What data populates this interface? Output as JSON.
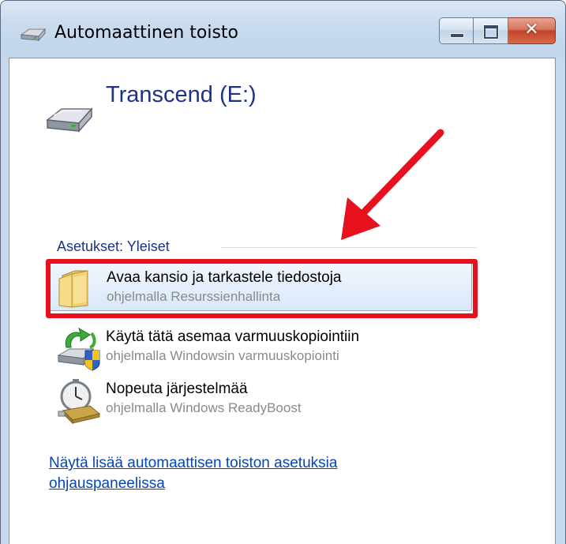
{
  "window": {
    "title": "Automaattinen toisto",
    "caption_buttons": {
      "minimize_icon": "minimize-icon",
      "maximize_icon": "maximize-icon",
      "close_glyph": "✕"
    }
  },
  "device": {
    "name": "Transcend (E:)",
    "icon": "removable-drive-icon"
  },
  "section": {
    "title": "Asetukset: Yleiset"
  },
  "options": [
    {
      "title": "Avaa kansio ja tarkastele tiedostoja",
      "subtitle": "ohjelmalla Resurssienhallinta",
      "icon": "folder-icon",
      "selected": true
    },
    {
      "title": "Käytä tätä asemaa varmuuskopiointiin",
      "subtitle": "ohjelmalla Windowsin varmuuskopiointi",
      "icon": "backup-icon",
      "selected": false
    },
    {
      "title": "Nopeuta järjestelmää",
      "subtitle": "ohjelmalla Windows ReadyBoost",
      "icon": "readyboost-icon",
      "selected": false
    }
  ],
  "link": {
    "text": "Näytä lisää automaattisen toiston asetuksia ohjauspaneelissa"
  },
  "annotation": {
    "color": "#e8101c"
  }
}
